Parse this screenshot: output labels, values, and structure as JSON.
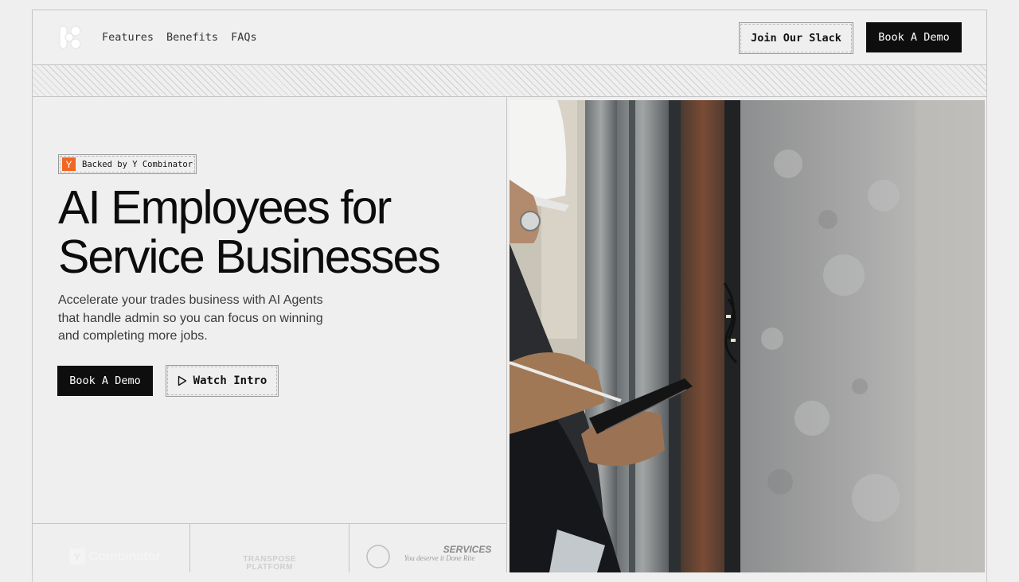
{
  "nav": {
    "links": [
      "Features",
      "Benefits",
      "FAQs"
    ],
    "join_label": "Join Our Slack",
    "demo_label": "Book A Demo"
  },
  "hero": {
    "badge_mark": "Y",
    "badge_text": "Backed by Y Combinator",
    "headline_line1": "AI Employees for",
    "headline_line2": "Service Businesses",
    "subtitle": "Accelerate your trades business with AI Agents that handle admin so you can focus on winning and completing more jobs.",
    "primary_cta": "Book A Demo",
    "secondary_cta": "Watch Intro"
  },
  "logos": {
    "yc": "Combinator",
    "transpose_line1": "TRANSPOSE",
    "transpose_line2": "PLATFORM",
    "services": "SERVICES",
    "services_tagline": "You deserve it Done Rite"
  },
  "colors": {
    "background": "#efefef",
    "dark_button": "#0e0e0e",
    "yc_orange": "#f26522"
  },
  "icons": [
    "logo-mark-icon",
    "play-icon",
    "yc-icon"
  ]
}
